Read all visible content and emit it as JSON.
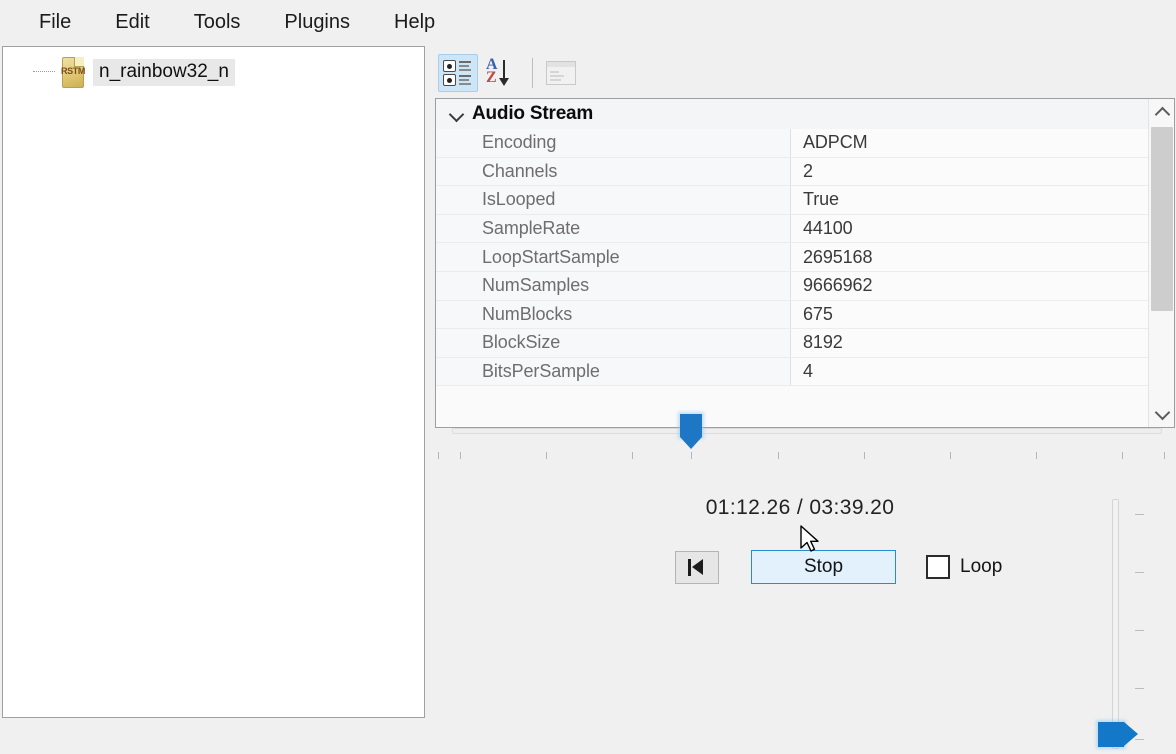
{
  "menubar": {
    "items": [
      {
        "label": "File"
      },
      {
        "label": "Edit"
      },
      {
        "label": "Tools"
      },
      {
        "label": "Plugins"
      },
      {
        "label": "Help"
      }
    ]
  },
  "tree": {
    "node": {
      "label": "n_rainbow32_n",
      "icon_tag": "RSTM",
      "icon": "rstm-file-icon"
    }
  },
  "toolbar": {
    "categorized": {
      "name": "categorized-view-icon",
      "tooltip": "Categorized"
    },
    "alphabetical": {
      "name": "alphabetical-sort-icon",
      "letter_a": "A",
      "letter_z": "Z"
    },
    "property_pages": {
      "name": "property-pages-icon"
    }
  },
  "property_grid": {
    "category": {
      "label": "Audio Stream",
      "expanded": true
    },
    "rows": [
      {
        "name": "Encoding",
        "value": "ADPCM"
      },
      {
        "name": "Channels",
        "value": "2"
      },
      {
        "name": "IsLooped",
        "value": "True"
      },
      {
        "name": "SampleRate",
        "value": "44100"
      },
      {
        "name": "LoopStartSample",
        "value": "2695168"
      },
      {
        "name": "NumSamples",
        "value": "9666962"
      },
      {
        "name": "NumBlocks",
        "value": "675"
      },
      {
        "name": "BlockSize",
        "value": "8192"
      },
      {
        "name": "BitsPerSample",
        "value": "4"
      }
    ]
  },
  "player": {
    "seek": {
      "position_fraction": 0.33,
      "tick_count": 9
    },
    "time": {
      "elapsed": "01:12.26",
      "separator": "/",
      "total": "03:39.20",
      "display": "01:12.26 / 03:39.20"
    },
    "controls": {
      "restart_label": "",
      "restart_icon": "skip-to-start-icon",
      "stop_label": "Stop",
      "loop_label": "Loop",
      "loop_checked": false
    },
    "volume": {
      "value_fraction": 0.08,
      "tick_count": 5
    }
  },
  "colors": {
    "accent": "#1378c8",
    "seek_thumb": "#1d77c4",
    "hover_button_bg": "#e2f1fb",
    "hover_button_border": "#2a8ad4",
    "toolbar_checked_bg": "#cde6f7",
    "file_icon": "#d9c169",
    "window_bg": "#f0f0f0"
  }
}
